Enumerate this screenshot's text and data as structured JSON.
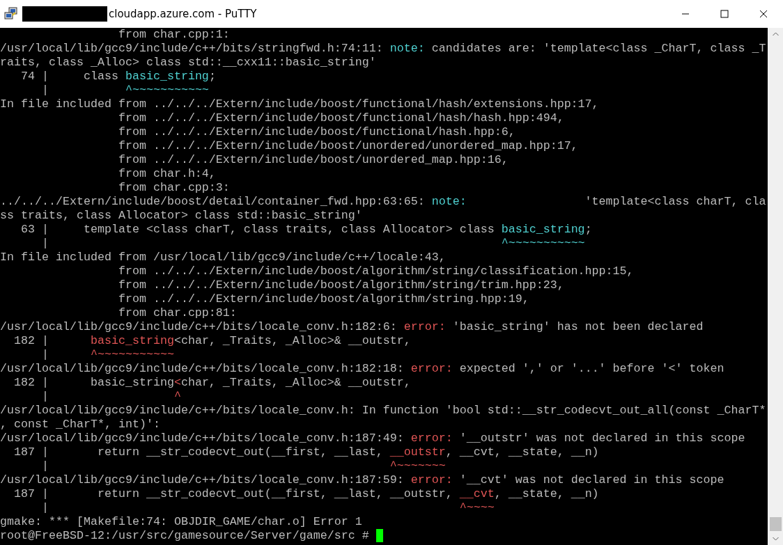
{
  "window": {
    "title": "cloudapp.azure.com - PuTTY"
  },
  "terminal": {
    "lines": [
      {
        "segments": [
          {
            "kind": "plain",
            "text": "                 from char.cpp:1:"
          }
        ]
      },
      {
        "segments": [
          {
            "kind": "plain",
            "text": "/usr/local/lib/gcc9/include/c++/bits/stringfwd.h:74:11: "
          },
          {
            "kind": "note",
            "text": "note:"
          },
          {
            "kind": "plain",
            "text": " candidates are: 'template<class _CharT, class _T"
          }
        ]
      },
      {
        "segments": [
          {
            "kind": "plain",
            "text": "raits, class _Alloc> class std::__cxx11::basic_string'"
          }
        ]
      },
      {
        "segments": [
          {
            "kind": "plain",
            "text": "   74 |     class "
          },
          {
            "kind": "note",
            "text": "basic_string"
          },
          {
            "kind": "plain",
            "text": ";"
          }
        ]
      },
      {
        "segments": [
          {
            "kind": "plain",
            "text": "      |           "
          },
          {
            "kind": "note",
            "text": "^~~~~~~~~~~~"
          }
        ]
      },
      {
        "segments": [
          {
            "kind": "plain",
            "text": "In file included from ../../../Extern/include/boost/functional/hash/extensions.hpp:17,"
          }
        ]
      },
      {
        "segments": [
          {
            "kind": "plain",
            "text": "                 from ../../../Extern/include/boost/functional/hash/hash.hpp:494,"
          }
        ]
      },
      {
        "segments": [
          {
            "kind": "plain",
            "text": "                 from ../../../Extern/include/boost/functional/hash.hpp:6,"
          }
        ]
      },
      {
        "segments": [
          {
            "kind": "plain",
            "text": "                 from ../../../Extern/include/boost/unordered/unordered_map.hpp:17,"
          }
        ]
      },
      {
        "segments": [
          {
            "kind": "plain",
            "text": "                 from ../../../Extern/include/boost/unordered_map.hpp:16,"
          }
        ]
      },
      {
        "segments": [
          {
            "kind": "plain",
            "text": "                 from char.h:4,"
          }
        ]
      },
      {
        "segments": [
          {
            "kind": "plain",
            "text": "                 from char.cpp:3:"
          }
        ]
      },
      {
        "segments": [
          {
            "kind": "plain",
            "text": "../../../Extern/include/boost/detail/container_fwd.hpp:63:65: "
          },
          {
            "kind": "note",
            "text": "note:"
          },
          {
            "kind": "plain",
            "text": "                 'template<class charT, cla"
          }
        ]
      },
      {
        "segments": [
          {
            "kind": "plain",
            "text": "ss traits, class Allocator> class std::basic_string'"
          }
        ]
      },
      {
        "segments": [
          {
            "kind": "plain",
            "text": "   63 |     template <class charT, class traits, class Allocator> class "
          },
          {
            "kind": "note",
            "text": "basic_string"
          },
          {
            "kind": "plain",
            "text": ";"
          }
        ]
      },
      {
        "segments": [
          {
            "kind": "plain",
            "text": "      |                                                                 "
          },
          {
            "kind": "note",
            "text": "^~~~~~~~~~~~"
          }
        ]
      },
      {
        "segments": [
          {
            "kind": "plain",
            "text": "In file included from /usr/local/lib/gcc9/include/c++/locale:43,"
          }
        ]
      },
      {
        "segments": [
          {
            "kind": "plain",
            "text": "                 from ../../../Extern/include/boost/algorithm/string/classification.hpp:15,"
          }
        ]
      },
      {
        "segments": [
          {
            "kind": "plain",
            "text": "                 from ../../../Extern/include/boost/algorithm/string/trim.hpp:23,"
          }
        ]
      },
      {
        "segments": [
          {
            "kind": "plain",
            "text": "                 from ../../../Extern/include/boost/algorithm/string.hpp:19,"
          }
        ]
      },
      {
        "segments": [
          {
            "kind": "plain",
            "text": "                 from char.cpp:81:"
          }
        ]
      },
      {
        "segments": [
          {
            "kind": "plain",
            "text": "/usr/local/lib/gcc9/include/c++/bits/locale_conv.h:182:6: "
          },
          {
            "kind": "error",
            "text": "error:"
          },
          {
            "kind": "plain",
            "text": " 'basic_string' has not been declared"
          }
        ]
      },
      {
        "segments": [
          {
            "kind": "plain",
            "text": "  182 |      "
          },
          {
            "kind": "error",
            "text": "basic_string"
          },
          {
            "kind": "plain",
            "text": "<char, _Traits, _Alloc>& __outstr,"
          }
        ]
      },
      {
        "segments": [
          {
            "kind": "plain",
            "text": "      |      "
          },
          {
            "kind": "error",
            "text": "^~~~~~~~~~~~"
          }
        ]
      },
      {
        "segments": [
          {
            "kind": "plain",
            "text": "/usr/local/lib/gcc9/include/c++/bits/locale_conv.h:182:18: "
          },
          {
            "kind": "error",
            "text": "error:"
          },
          {
            "kind": "plain",
            "text": " expected ',' or '...' before '<' token"
          }
        ]
      },
      {
        "segments": [
          {
            "kind": "plain",
            "text": "  182 |      basic_string"
          },
          {
            "kind": "error",
            "text": "<"
          },
          {
            "kind": "plain",
            "text": "char, _Traits, _Alloc>& __outstr,"
          }
        ]
      },
      {
        "segments": [
          {
            "kind": "plain",
            "text": "      |                  "
          },
          {
            "kind": "error",
            "text": "^"
          }
        ]
      },
      {
        "segments": [
          {
            "kind": "plain",
            "text": "/usr/local/lib/gcc9/include/c++/bits/locale_conv.h: In function 'bool std::__str_codecvt_out_all(const _CharT*"
          }
        ]
      },
      {
        "segments": [
          {
            "kind": "plain",
            "text": ", const _CharT*, int)':"
          }
        ]
      },
      {
        "segments": [
          {
            "kind": "plain",
            "text": "/usr/local/lib/gcc9/include/c++/bits/locale_conv.h:187:49: "
          },
          {
            "kind": "error",
            "text": "error:"
          },
          {
            "kind": "plain",
            "text": " '__outstr' was not declared in this scope"
          }
        ]
      },
      {
        "segments": [
          {
            "kind": "plain",
            "text": "  187 |       return __str_codecvt_out(__first, __last, "
          },
          {
            "kind": "error",
            "text": "__outstr"
          },
          {
            "kind": "plain",
            "text": ", __cvt, __state, __n)"
          }
        ]
      },
      {
        "segments": [
          {
            "kind": "plain",
            "text": "      |                                                 "
          },
          {
            "kind": "error",
            "text": "^~~~~~~~"
          }
        ]
      },
      {
        "segments": [
          {
            "kind": "plain",
            "text": "/usr/local/lib/gcc9/include/c++/bits/locale_conv.h:187:59: "
          },
          {
            "kind": "error",
            "text": "error:"
          },
          {
            "kind": "plain",
            "text": " '__cvt' was not declared in this scope"
          }
        ]
      },
      {
        "segments": [
          {
            "kind": "plain",
            "text": "  187 |       return __str_codecvt_out(__first, __last, __outstr, "
          },
          {
            "kind": "error",
            "text": "__cvt"
          },
          {
            "kind": "plain",
            "text": ", __state, __n)"
          }
        ]
      },
      {
        "segments": [
          {
            "kind": "plain",
            "text": "      |                                                           "
          },
          {
            "kind": "error",
            "text": "^~~~~"
          }
        ]
      },
      {
        "segments": [
          {
            "kind": "plain",
            "text": "gmake: *** [Makefile:74: OBJDIR_GAME/char.o] Error 1"
          }
        ]
      },
      {
        "segments": [
          {
            "kind": "plain",
            "text": "root@FreeBSD-12:/usr/src/gamesource/Server/game/src # "
          }
        ]
      }
    ]
  }
}
